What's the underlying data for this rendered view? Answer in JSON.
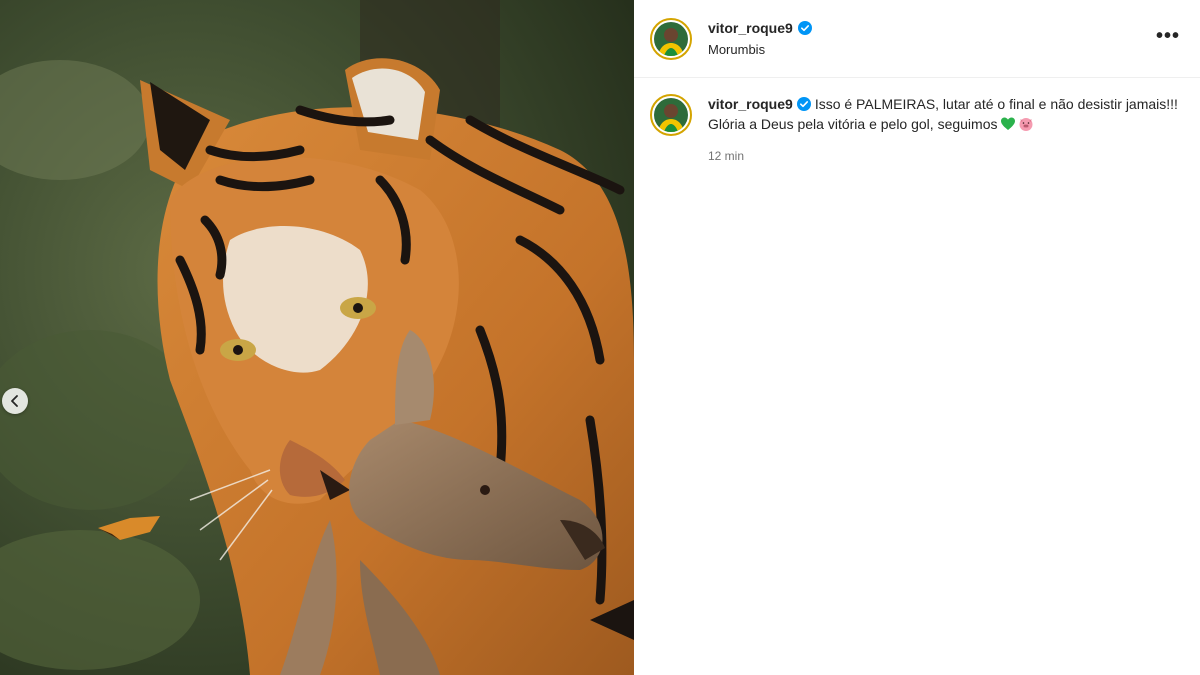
{
  "post": {
    "username": "vitor_roque9",
    "location": "Morumbis",
    "more_label": "•••"
  },
  "caption": {
    "username": "vitor_roque9",
    "line1": "Isso é PALMEIRAS, lutar até o final e não desistir jamais!!!",
    "line2": "Glória a Deus pela vitória e pelo gol, seguimos",
    "emojis": [
      "green-heart",
      "pig-face"
    ],
    "time": "12 min"
  },
  "media": {
    "description_icon": "tiger-carrying-prey-photo",
    "prev_icon": "chevron-left-icon"
  },
  "colors": {
    "verified": "#0095f6",
    "avatar_ring": "#d4a400",
    "text": "#262626",
    "muted": "#737373"
  }
}
